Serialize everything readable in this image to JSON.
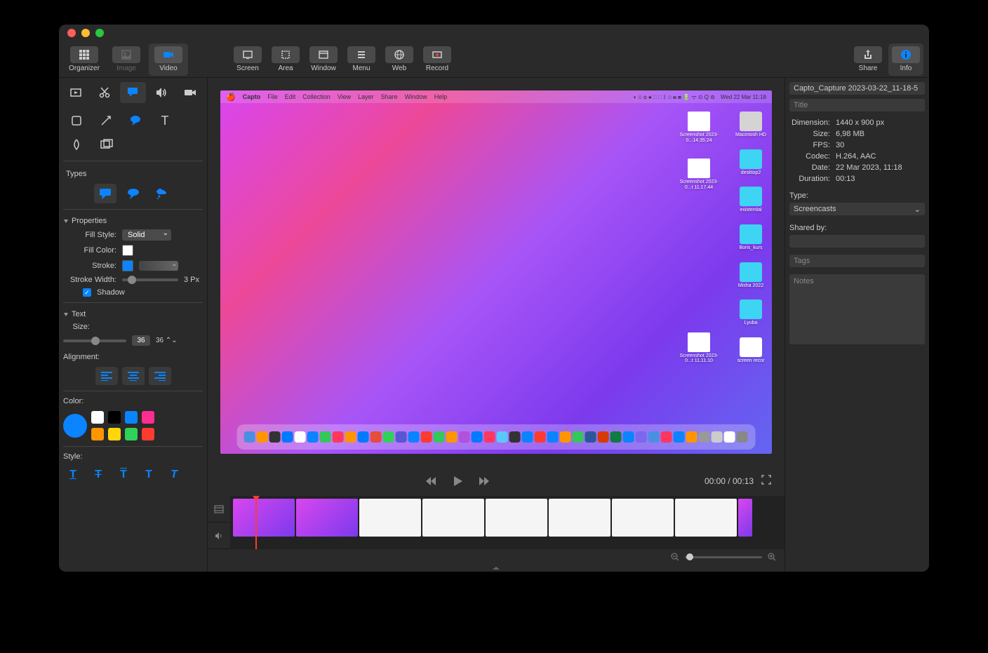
{
  "toolbar": {
    "organizer": "Organizer",
    "image": "Image",
    "video": "Video",
    "screen": "Screen",
    "area": "Area",
    "window": "Window",
    "menu": "Menu",
    "web": "Web",
    "record": "Record",
    "share": "Share",
    "info": "Info"
  },
  "left": {
    "types_label": "Types",
    "properties_label": "Properties",
    "fill_style_label": "Fill Style:",
    "fill_style_value": "Solid",
    "fill_color_label": "Fill Color:",
    "stroke_label": "Stroke:",
    "stroke_width_label": "Stroke Width:",
    "stroke_width_value": "3 Px",
    "shadow_label": "Shadow",
    "text_label": "Text",
    "size_label": "Size:",
    "size_value": "36",
    "size_value2": "36",
    "alignment_label": "Alignment:",
    "color_label": "Color:",
    "style_label": "Style:"
  },
  "preview": {
    "menubar_app": "Capto",
    "menubar_items": [
      "File",
      "Edit",
      "Collection",
      "View",
      "Layer",
      "Share",
      "Window",
      "Help"
    ],
    "clock": "Wed 22 Mar 11:18",
    "desktop_right": [
      {
        "label": "Macintosh HD",
        "type": "drive"
      },
      {
        "label": "desktop2",
        "type": "folder"
      },
      {
        "label": "existential",
        "type": "folder"
      },
      {
        "label": "Boris_kurs",
        "type": "folder"
      },
      {
        "label": "Misha 2022",
        "type": "folder"
      },
      {
        "label": "Lyuba",
        "type": "folder"
      },
      {
        "label": "screen recor",
        "type": "file"
      }
    ],
    "desktop_left": [
      {
        "label": "Screenshot 2023-0...14.35.24",
        "type": "screenshot"
      },
      {
        "label": "Screenshot 2023-0...t 11.17.44",
        "type": "screenshot"
      },
      {
        "label": "Screenshot 2023-0...t 11.11.10",
        "type": "screenshot"
      }
    ]
  },
  "playback": {
    "time": "00:00 / 00:13"
  },
  "info": {
    "filename": "Capto_Capture 2023-03-22_11-18-5",
    "title_placeholder": "Title",
    "dimension_label": "Dimension:",
    "dimension_value": "1440 x 900 px",
    "size_label": "Size:",
    "size_value": "6,98 MB",
    "fps_label": "FPS:",
    "fps_value": "30",
    "codec_label": "Codec:",
    "codec_value": "H.264, AAC",
    "date_label": "Date:",
    "date_value": "22 Mar 2023, 11:18",
    "duration_label": "Duration:",
    "duration_value": "00:13",
    "type_label": "Type:",
    "type_value": "Screencasts",
    "shared_by_label": "Shared by:",
    "tags_placeholder": "Tags",
    "notes_placeholder": "Notes"
  },
  "colors": {
    "accent": "#0a84ff",
    "palette_main": "#0a84ff",
    "palette": [
      "#ffffff",
      "#000000",
      "#0a84ff",
      "#ff2d92",
      "#ff9500",
      "#ffd60a",
      "#30d158",
      "#ff3b30"
    ]
  }
}
